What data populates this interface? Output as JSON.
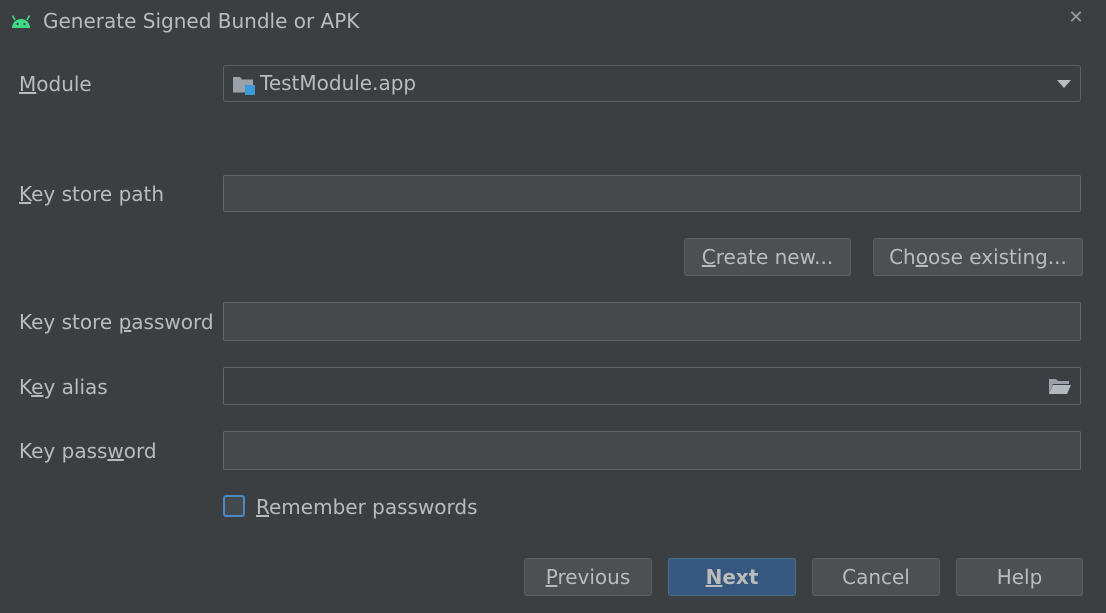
{
  "dialog": {
    "title": "Generate Signed Bundle or APK",
    "close_glyph": "✕"
  },
  "module": {
    "label_first": "M",
    "label_rest": "odule",
    "value": "TestModule.app"
  },
  "keystore": {
    "path_label_first": "K",
    "path_label_rest": "ey store path",
    "path_value": "",
    "create_first": "C",
    "create_rest": "reate new...",
    "choose_pre": "Ch",
    "choose_u": "o",
    "choose_post": "ose existing...",
    "password_label_pre": "Key store ",
    "password_label_u": "p",
    "password_label_post": "assword",
    "password_value": ""
  },
  "key": {
    "alias_label_pre": "K",
    "alias_label_u": "e",
    "alias_label_post": "y alias",
    "alias_value": "",
    "password_label_pre": "Key pass",
    "password_label_u": "w",
    "password_label_post": "ord",
    "password_value": ""
  },
  "remember": {
    "checked": false,
    "label_first": "R",
    "label_rest": "emember passwords"
  },
  "footer": {
    "previous_first": "P",
    "previous_rest": "revious",
    "next_first": "N",
    "next_rest": "ext",
    "cancel": "Cancel",
    "help": "Help"
  },
  "colors": {
    "background": "#3c3f41",
    "field": "#45494a",
    "accent": "#365880",
    "android": "#3ddc84",
    "module_badge": "#3d9ad6"
  },
  "icons": [
    "android-icon",
    "close-icon",
    "module-folder-icon",
    "dropdown-caret-icon",
    "folder-open-icon"
  ]
}
